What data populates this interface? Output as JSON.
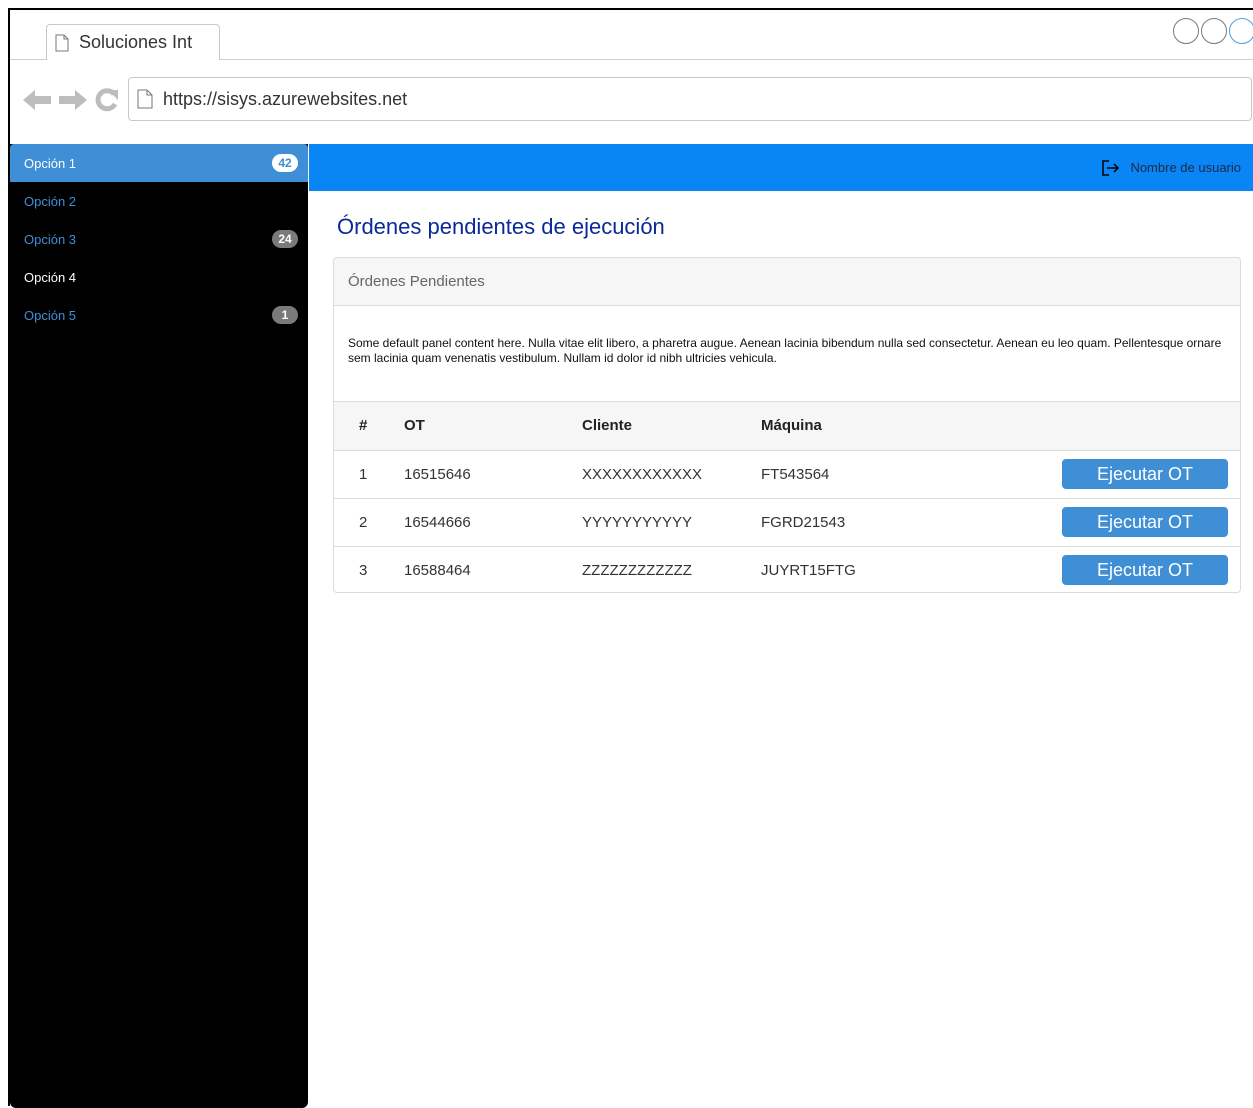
{
  "browser": {
    "tab_title": "Soluciones Int",
    "url": "https://sisys.azurewebsites.net"
  },
  "sidebar": {
    "items": [
      {
        "label": "Opción 1",
        "badge": "42"
      },
      {
        "label": "Opción 2",
        "badge": ""
      },
      {
        "label": "Opción 3",
        "badge": "24"
      },
      {
        "label": "Opción 4",
        "badge": ""
      },
      {
        "label": "Opción 5",
        "badge": "1"
      }
    ]
  },
  "header": {
    "user_name": "Nombre de usuario"
  },
  "main": {
    "title": "Órdenes pendientes de ejecución",
    "panel": {
      "heading": "Órdenes Pendientes",
      "body": "Some default panel content here. Nulla vitae elit libero, a pharetra augue. Aenean lacinia bibendum nulla sed consectetur. Aenean eu leo quam. Pellentesque ornare sem lacinia quam venenatis vestibulum. Nullam id dolor id nibh ultricies vehicula.",
      "columns": [
        "#",
        "OT",
        "Cliente",
        "Máquina"
      ],
      "rows": [
        {
          "n": "1",
          "ot": "16515646",
          "cliente": "XXXXXXXXXXXX",
          "maquina": "FT543564",
          "action": "Ejecutar OT"
        },
        {
          "n": "2",
          "ot": "16544666",
          "cliente": "YYYYYYYYYYY",
          "maquina": "FGRD21543",
          "action": "Ejecutar OT"
        },
        {
          "n": "3",
          "ot": "16588464",
          "cliente": "ZZZZZZZZZZZZ",
          "maquina": "JUYRT15FTG",
          "action": "Ejecutar OT"
        }
      ]
    }
  },
  "colors": {
    "accent": "#3f8fd6",
    "topbar": "#0a85f5",
    "title": "#0a2a99",
    "sidebar_bg": "#000000"
  }
}
